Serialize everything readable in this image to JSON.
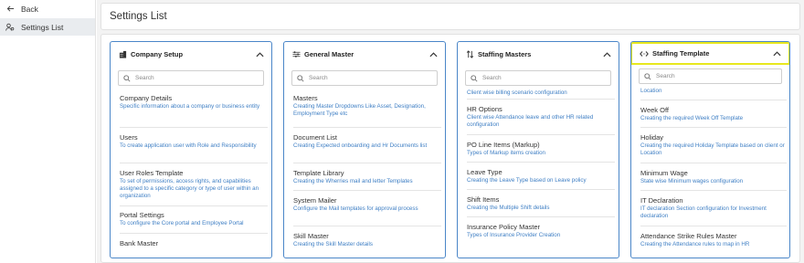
{
  "sidebar": {
    "back_label": "Back",
    "settings_label": "Settings List"
  },
  "page": {
    "title": "Settings List"
  },
  "search_placeholder": "Search",
  "cards": [
    {
      "title": "Company Setup",
      "icon": "building-icon",
      "items": [
        {
          "name": "Company Details",
          "desc": "Specific information about a company or business entity"
        },
        {
          "name": "Users",
          "desc": "To create application user with Role and Responsibility"
        },
        {
          "name": "User Roles Template",
          "desc": "To set of permissions, access rights, and capabilities assigned to a specific category or type of user within an organization"
        },
        {
          "name": "Portal Settings",
          "desc": "To configure the Core portal and Employee Portal"
        },
        {
          "name": "Bank Master",
          "desc": ""
        }
      ]
    },
    {
      "title": "General Master",
      "icon": "sliders-icon",
      "items": [
        {
          "name": "Masters",
          "desc": "Creating Master Dropdowns Like Asset, Designation, Employment Type etc"
        },
        {
          "name": "Document List",
          "desc": "Creating Expected onboarding and Hr Documents list"
        },
        {
          "name": "Template Library",
          "desc": "Creating the Wherries mail and letter Templates"
        },
        {
          "name": "System Mailer",
          "desc": "Configure the Mail templates for approval process"
        },
        {
          "name": "Skill Master",
          "desc": "Creating the Skill Master details"
        }
      ]
    },
    {
      "title": "Staffing Masters",
      "icon": "sort-arrows-icon",
      "items": [
        {
          "name": "",
          "desc": "Client wise billing scenario configuration"
        },
        {
          "name": "HR Options",
          "desc": "Client wise Attendance leave and other HR related configuration"
        },
        {
          "name": "PO Line Items (Markup)",
          "desc": "Types of Markup items creation"
        },
        {
          "name": "Leave Type",
          "desc": "Creating the Leave Type based on Leave policy"
        },
        {
          "name": "Shift Items",
          "desc": "Creating the Multiple Shift details"
        },
        {
          "name": "Insurance Policy Master",
          "desc": "Types of Insurance Provider Creation"
        }
      ]
    },
    {
      "title": "Staffing Template",
      "icon": "code-icon",
      "items": [
        {
          "name": "",
          "desc": "Location"
        },
        {
          "name": "Week Off",
          "desc": "Creating the required Week Off Template"
        },
        {
          "name": "Holiday",
          "desc": "Creating the required Holiday Template based on client or Location"
        },
        {
          "name": "Minimum Wage",
          "desc": "State wise Minimum wages configuration"
        },
        {
          "name": "IT Declaration",
          "desc": "IT declaration Section configuration for Investment declaration"
        },
        {
          "name": "Attendance Strike Rules Master",
          "desc": "Creating the Attendance rules to map in HR"
        }
      ]
    }
  ]
}
